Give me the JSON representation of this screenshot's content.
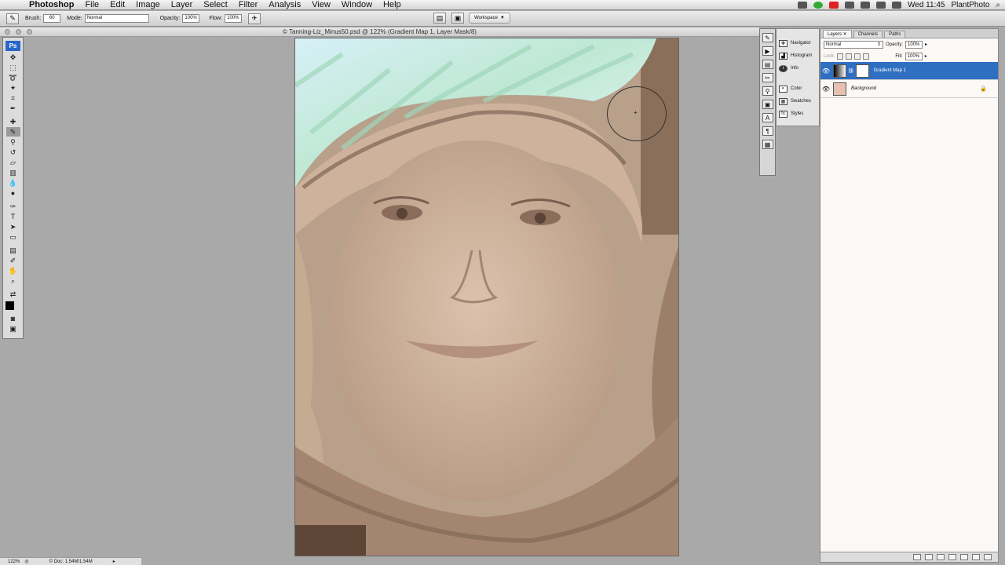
{
  "menubar": {
    "app": "Photoshop",
    "items": [
      "File",
      "Edit",
      "Image",
      "Layer",
      "Select",
      "Filter",
      "Analysis",
      "View",
      "Window",
      "Help"
    ],
    "clock": "Wed 11:45",
    "user": "PlantPhoto"
  },
  "options": {
    "brush_label": "Brush:",
    "brush_size": "60",
    "mode_label": "Mode:",
    "mode_value": "Normal",
    "opacity_label": "Opacity:",
    "opacity_value": "100%",
    "flow_label": "Flow:",
    "flow_value": "100%",
    "workspace_label": "Workspace"
  },
  "document": {
    "title": "© Tanning-Liz_Minus50.psd @ 122% (Gradient Map 1, Layer Mask/8)"
  },
  "tools": {
    "logo": "Ps"
  },
  "panels": {
    "group_items": [
      "Navigator",
      "Histogram",
      "Info"
    ],
    "group_items_2": [
      "Color",
      "Swatches",
      "Styles"
    ]
  },
  "layers": {
    "tabs": [
      "Layers",
      "Channels",
      "Paths"
    ],
    "blend_mode": "Normal",
    "opacity_label": "Opacity:",
    "opacity_value": "100%",
    "lock_label": "Lock:",
    "fill_label": "Fill:",
    "fill_value": "100%",
    "rows": [
      {
        "name": "Gradient Map 1",
        "selected": true
      },
      {
        "name": "Background",
        "selected": false
      }
    ]
  },
  "status": {
    "zoom": "122%",
    "doc": "© Doc: 1.54M/1.54M"
  },
  "colors": {
    "selection": "#2f6fc2",
    "canvas_bg": "#a9a9a9",
    "sepia": "#c9b09a"
  }
}
